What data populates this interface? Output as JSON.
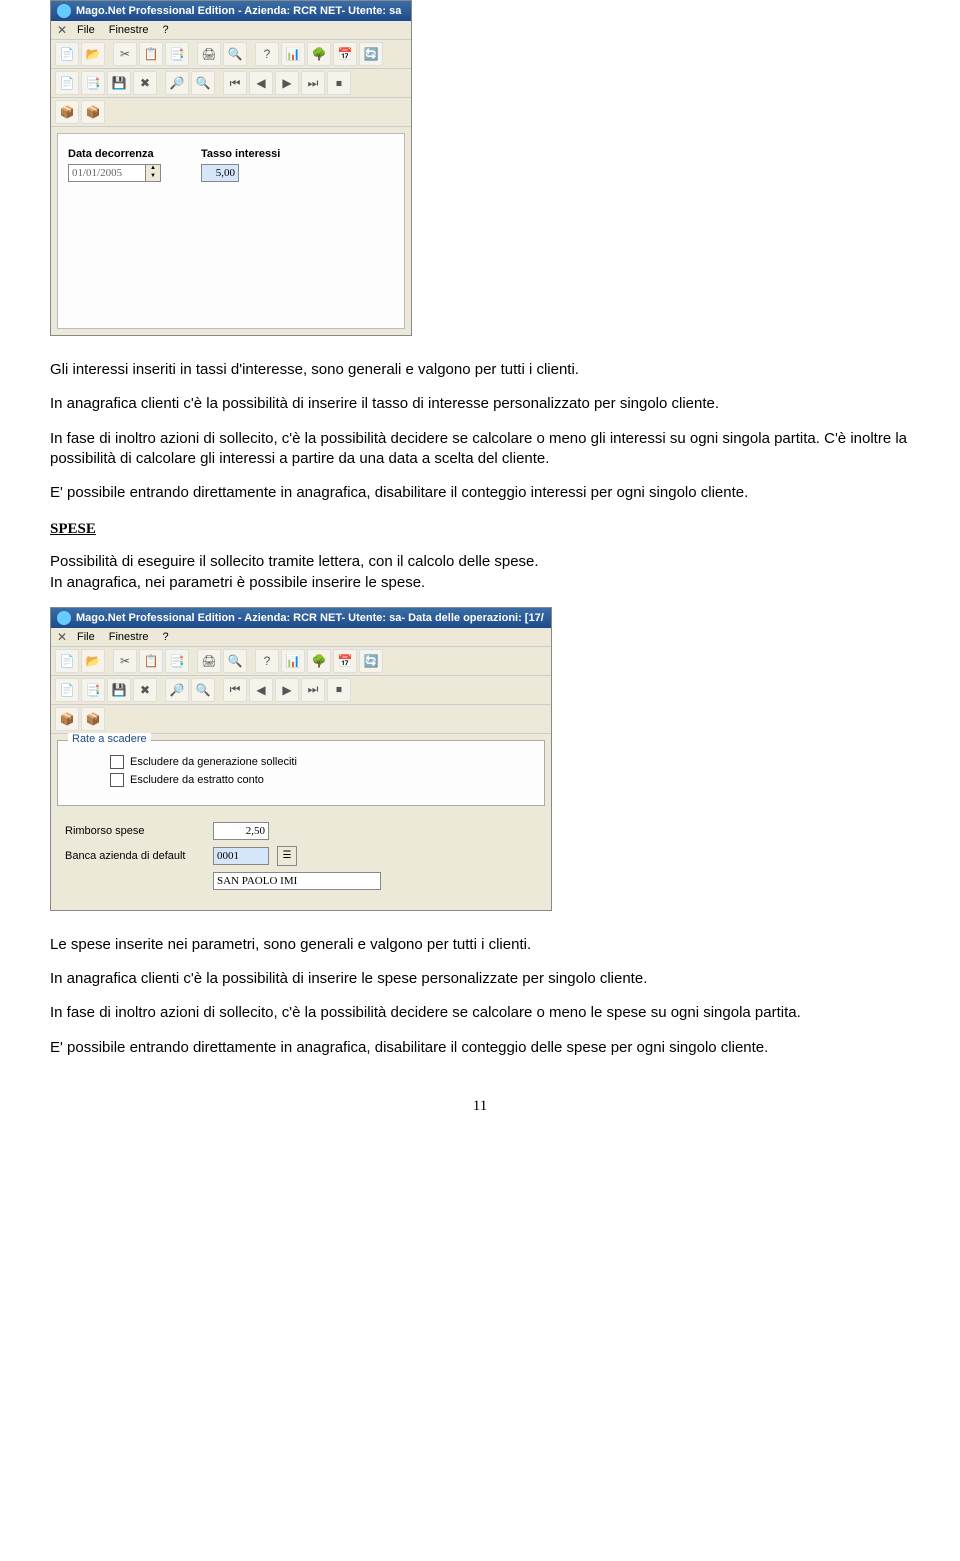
{
  "window1": {
    "title": "Mago.Net Professional Edition - Azienda: RCR NET- Utente: sa",
    "menu": {
      "file": "File",
      "win": "Finestre",
      "help": "?"
    },
    "form": {
      "date_label": "Data decorrenza",
      "date_value": "01/01/2005",
      "rate_label": "Tasso interessi",
      "rate_value": "5,00"
    }
  },
  "window2": {
    "title": "Mago.Net Professional Edition - Azienda: RCR NET- Utente: sa- Data delle operazioni: [17/",
    "menu": {
      "file": "File",
      "win": "Finestre",
      "help": "?"
    },
    "legend": "Rate a scadere",
    "chk1": "Escludere da generazione solleciti",
    "chk2": "Escludere da estratto conto",
    "rimborso_label": "Rimborso spese",
    "rimborso_value": "2,50",
    "banca_label": "Banca azienda di default",
    "banca_code": "0001",
    "banca_name": "SAN PAOLO IMI"
  },
  "paragraphs": {
    "p1": "Gli interessi inseriti in tassi d'interesse, sono generali e valgono per tutti i clienti.",
    "p2": "In anagrafica clienti c'è la possibilità di inserire il tasso di interesse personalizzato per singolo cliente.",
    "p3": "In fase di inoltro azioni di sollecito, c'è la possibilità decidere se calcolare o meno gli interessi su ogni singola partita. C'è inoltre la possibilità di calcolare gli interessi a partire da una data a scelta del cliente.",
    "p4": "E' possibile entrando direttamente in anagrafica, disabilitare il conteggio interessi per ogni singolo cliente.",
    "spese_title": "SPESE",
    "p5": "Possibilità di eseguire il sollecito tramite lettera, con il calcolo delle spese.",
    "p6": "In anagrafica, nei parametri è possibile inserire le spese.",
    "p7": "Le spese inserite nei parametri, sono generali e valgono per tutti i clienti.",
    "p8": "In anagrafica clienti c'è la possibilità di inserire le spese personalizzate per singolo cliente.",
    "p9": "In fase di inoltro azioni di sollecito, c'è la possibilità decidere se calcolare o meno le spese su ogni singola partita.",
    "p10": "E' possibile entrando direttamente in anagrafica, disabilitare il conteggio delle spese per ogni singolo cliente."
  },
  "page_number": "11"
}
